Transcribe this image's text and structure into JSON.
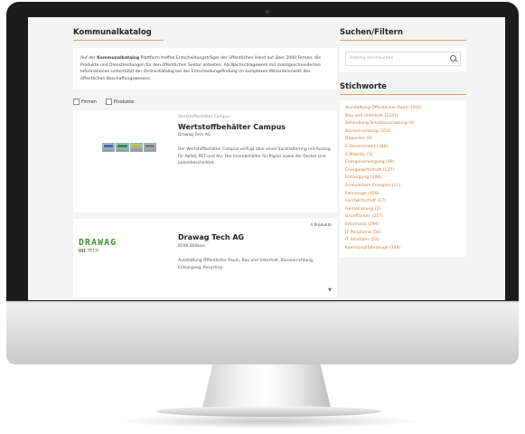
{
  "header": {
    "title": "Kommunalkatalog"
  },
  "intro": {
    "text_start": "Auf der ",
    "bold": "Kommunalkatalog",
    "text_rest": " Plattform treffen Entscheidungsträger der öffentlichen Hand auf über 2000 Firmen, die Produkte und Dienstleistungen für den öffentlichen Sektor anbieten. Als Nachschlagewerk mit massgeschneiderten Informationen unterstützt der Online-Katalog bei der Entscheidungsfindung im komplexen Milliardenmarkt des öffentlichen Beschaffungswesens."
  },
  "filters": {
    "firms": "Firmen",
    "products": "Produkte"
  },
  "cards": [
    {
      "category": "Wertstoffbehälter Campus",
      "title": "Wertstoffbehälter Campus",
      "company": "Drawag Tech AG",
      "description": "Der Wertstoffbehälter Campus verfügt über einen Sackhalterring mit Auszug für Abfall, PET und Alu. Der Innenbehälter für Papier sowie der Deckel sind pulverbeschichtet."
    },
    {
      "count": "4 Produkte",
      "title": "Drawag Tech AG",
      "location": "8108 Dällikon",
      "description": "Ausstattung Öffentlicher Raum, Bau und Unterhalt, Büroeinrichtung, Entsorgung, Recycling",
      "logo_main": "DRAWAG",
      "logo_sub": "TECH"
    }
  ],
  "sidebar": {
    "search_heading": "Suchen/Filtern",
    "search_placeholder": "Katalog durchsuchen",
    "tags_heading": "Stichworte",
    "tags": [
      "Ausstattung Öffentlicher Raum (502)",
      "Bau und Unterhalt (1541)",
      "Behindlung Schutzausrüstung (4)",
      "Büroeinrichtung (251)",
      "Deponien (9)",
      "E-Government (186)",
      "E-Mobility (1)",
      "Energieversorgung (99)",
      "Energiewirtschaft (137)",
      "Entsorgung (108)",
      "Erneuerbare Energien (17)",
      "Fahrzeuge (458)",
      "Forstwirtschaft (17)",
      "Gemeinerung (2)",
      "Grünflächen (257)",
      "Informatik (294)",
      "IT Peripherie (56)",
      "IT Solutions (53)",
      "Kommunalfahrzeuge (148)"
    ]
  }
}
